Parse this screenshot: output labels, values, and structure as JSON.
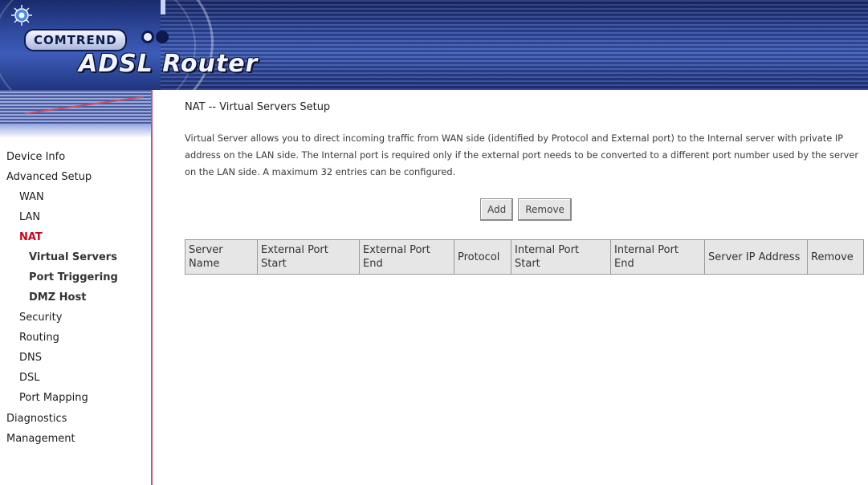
{
  "header": {
    "brand": "COMTREND",
    "product_title": "ADSL Router"
  },
  "sidebar": {
    "items": [
      {
        "label": "Device Info",
        "level": 0
      },
      {
        "label": "Advanced Setup",
        "level": 0
      },
      {
        "label": "WAN",
        "level": 1
      },
      {
        "label": "LAN",
        "level": 1
      },
      {
        "label": "NAT",
        "level": 1,
        "active": true
      },
      {
        "label": "Virtual Servers",
        "level": 2
      },
      {
        "label": "Port Triggering",
        "level": 2
      },
      {
        "label": "DMZ Host",
        "level": 2
      },
      {
        "label": "Security",
        "level": 1
      },
      {
        "label": "Routing",
        "level": 1
      },
      {
        "label": "DNS",
        "level": 1
      },
      {
        "label": "DSL",
        "level": 1
      },
      {
        "label": "Port Mapping",
        "level": 1
      },
      {
        "label": "Diagnostics",
        "level": 0
      },
      {
        "label": "Management",
        "level": 0
      }
    ]
  },
  "main": {
    "title": "NAT -- Virtual Servers Setup",
    "description": "Virtual Server allows you to direct incoming traffic from WAN side (identified by Protocol and External port) to the Internal server with private IP address on the LAN side. The Internal port is required only if the external port needs to be converted to a different port number used by the server on the LAN side. A maximum 32 entries can be configured.",
    "add_label": "Add",
    "remove_label": "Remove",
    "table": {
      "columns": [
        "Server Name",
        "External Port Start",
        "External Port End",
        "Protocol",
        "Internal Port Start",
        "Internal Port End",
        "Server IP Address",
        "Remove"
      ],
      "rows": []
    }
  },
  "colors": {
    "active_nav": "#d0021b",
    "header_blue": "#2f4aa0",
    "sidebar_border": "#c0566f"
  }
}
